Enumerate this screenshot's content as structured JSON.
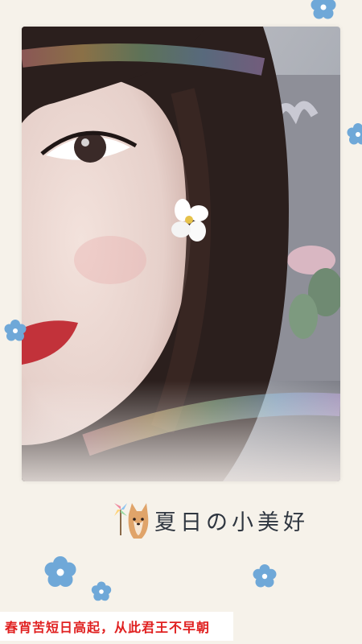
{
  "photo": {
    "subject": "selfie-portrait",
    "palette": {
      "skin": "#e6d0ca",
      "hair": "#2b1f1d",
      "lips": "#c2323a",
      "background": "#a8acb4",
      "rainbow": [
        "#ff9a9a",
        "#ffd47a",
        "#9ad8a0",
        "#8ec4f0",
        "#c9a8f0"
      ]
    }
  },
  "sticker": {
    "icon": "dog-with-pinwheel-icon",
    "text": "夏日の小美好"
  },
  "caption": {
    "text": "春宵苦短日高起，从此君王不早朝",
    "color": "#e02020"
  },
  "decor": {
    "flower_color": "#6fa8d8",
    "flower_center": "#ffffff"
  }
}
